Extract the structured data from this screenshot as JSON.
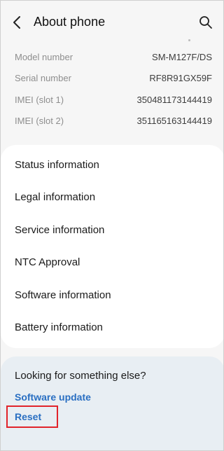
{
  "header": {
    "title": "About phone",
    "back_icon": "chevron-left-icon",
    "search_icon": "search-icon"
  },
  "device_info": [
    {
      "label": "Model number",
      "value": "SM-M127F/DS"
    },
    {
      "label": "Serial number",
      "value": "RF8R91GX59F"
    },
    {
      "label": "IMEI (slot 1)",
      "value": "350481173144419"
    },
    {
      "label": "IMEI (slot 2)",
      "value": "351165163144419"
    }
  ],
  "menu": [
    {
      "label": "Status information"
    },
    {
      "label": "Legal information"
    },
    {
      "label": "Service information"
    },
    {
      "label": "NTC Approval"
    },
    {
      "label": "Software information"
    },
    {
      "label": "Battery information"
    }
  ],
  "suggestions": {
    "title": "Looking for something else?",
    "links": [
      {
        "label": "Software update"
      },
      {
        "label": "Reset"
      }
    ]
  },
  "colors": {
    "link": "#2a6fc2",
    "highlight": "#e1232a",
    "suggest_background": "#e8eef3"
  }
}
